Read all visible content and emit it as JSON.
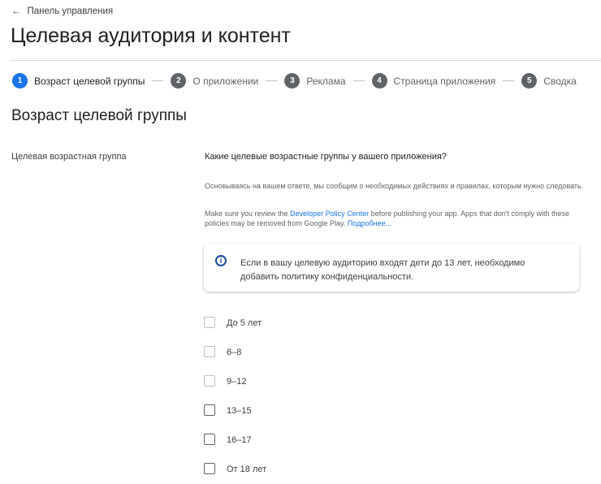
{
  "back_link": {
    "label": "Панель управления"
  },
  "page_title": "Целевая аудитория и контент",
  "stepper": [
    {
      "number": "1",
      "label": "Возраст целевой группы",
      "active": true
    },
    {
      "number": "2",
      "label": "О приложении"
    },
    {
      "number": "3",
      "label": "Реклама"
    },
    {
      "number": "4",
      "label": "Страница приложения"
    },
    {
      "number": "5",
      "label": "Сводка"
    }
  ],
  "section_title": "Возраст целевой группы",
  "side_label": "Целевая возрастная группа",
  "question": "Какие целевые возрастные группы у вашего приложения?",
  "description": "Основываясь на вашем ответе, мы сообщим о необходимых действиях и правилах, которым нужно следовать.",
  "policy": {
    "before": "Make sure you review the ",
    "link": "Developer Policy Center",
    "after": " before publishing your app. Apps that don't comply with these policies may be removed from Google Play. ",
    "more": "Подробнее..."
  },
  "info_card": {
    "icon": "info-icon",
    "text": "Если в вашу целевую аудиторию входят дети до 13 лет, необходимо добавить политику конфиденциальности."
  },
  "age_options": [
    {
      "label": "До 5 лет",
      "checked": false
    },
    {
      "label": "6–8",
      "checked": false
    },
    {
      "label": "9–12",
      "checked": false
    },
    {
      "label": "13–15",
      "checked": false
    },
    {
      "label": "16–17",
      "checked": false
    },
    {
      "label": "От 18 лет",
      "checked": false
    }
  ],
  "colors": {
    "accent": "#1a73e8",
    "step_inactive": "#5f6368"
  }
}
